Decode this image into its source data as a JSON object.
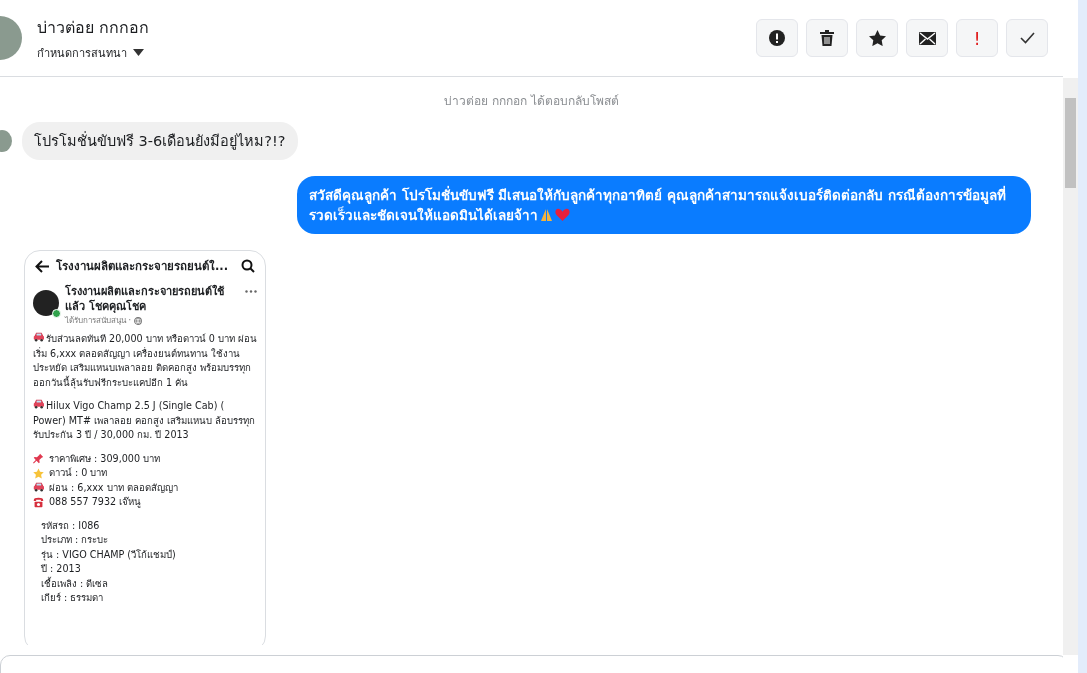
{
  "header": {
    "contact_name": "บ่าวต่อย กกกอก",
    "subtitle": "กำหนดการสนทนา",
    "actions": [
      {
        "kind": "alert"
      },
      {
        "kind": "trash"
      },
      {
        "kind": "star"
      },
      {
        "kind": "mail"
      },
      {
        "kind": "important",
        "label": "!"
      },
      {
        "kind": "done"
      }
    ]
  },
  "conversation": {
    "notice": "บ่าวต่อย กกกอก ได้ตอบกลับโพสต์",
    "messages": [
      {
        "kind": "received",
        "text": "โปรโมชั่นขับฟรี 3-6เดือนยังมีอยู่ไหม?!?"
      },
      {
        "kind": "sent",
        "text": "สวัสดีคุณลูกค้า โปรโมชั่นขับฟรี มีเสนอให้กับลูกค้าทุกอาทิตย์ คุณลูกค้าสามารถแจ้งเบอร์ติดต่อกลับ กรณีต้องการข้อมูลที่รวดเร็วและชัดเจนให้แอดมินได้เลยจ้าา"
      },
      {
        "kind": "post",
        "bar_title": "โรงงานผลิตและกระจายรถยนต์ใ...",
        "page_name": "โรงงานผลิตและกระจายรถยนต์ใช้แล้ว โชคคุณโชค",
        "sponsored": "ได้รับการสนับสนุน ·",
        "blocks": [
          {
            "kind": "paragraph",
            "text": "รับส่วนลดทันที 20,000 บาท หรือดาวน์ 0 บาท ผ่อนเริ่ม 6,xxx ตลอดสัญญา เครื่องยนต์ทนทาน ใช้งานประหยัด เสริมแหนบเพลาลอย ติดคอกสูง พร้อมบรรทุก ออกวันนี้ลุ้นรับฟรีกระบะแคปอีก 1 คัน"
          },
          {
            "kind": "paragraph",
            "text": "Hilux Vigo Champ 2.5 J (Single Cab) ( Power) MT# เพลาลอย คอกสูง เสริมแหนบ ล้อบรรทุก รับประกัน 3 ปี / 30,000 กม. ปี 2013"
          },
          {
            "kind": "list",
            "items": [
              {
                "kind": "pin",
                "text": "ราคาพิเศษ : 309,000 บาท"
              },
              {
                "kind": "star",
                "text": "ดาวน์ : 0 บาท"
              },
              {
                "kind": "car",
                "text": "ผ่อน : 6,xxx บาท ตลอดสัญญา"
              },
              {
                "kind": "phone",
                "text": "088 557 7932 เจ๊หนู"
              }
            ]
          },
          {
            "kind": "specs",
            "items": [
              "รหัสรถ : I086",
              "ประเภท : กระบะ",
              "รุ่น : VIGO CHAMP (วีโก้แชมป์)",
              "ปี : 2013",
              "เชื้อเพลิง : ดีเซล",
              "เกียร์ : ธรรมดา"
            ]
          }
        ]
      }
    ]
  }
}
